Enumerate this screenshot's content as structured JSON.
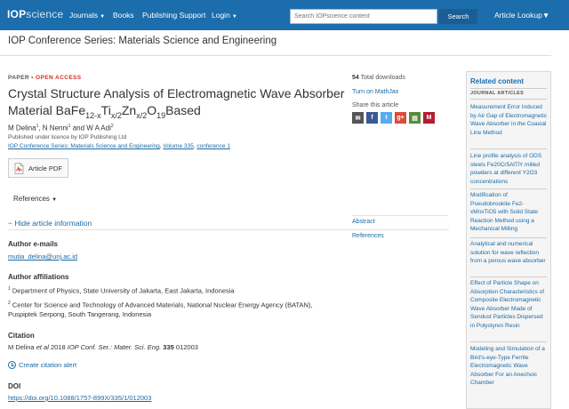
{
  "nav": {
    "logo_prefix": "IOP",
    "logo_suffix": "science",
    "journals": "Journals",
    "books": "Books",
    "publishing_support": "Publishing Support",
    "login": "Login",
    "search_placeholder": "Search IOPscience content",
    "search_button": "Search",
    "article_lookup": "Article Lookup"
  },
  "journal_title": "IOP Conference Series: Materials Science and Engineering",
  "article": {
    "paper_label": "PAPER",
    "separator": "•",
    "open_access": "OPEN ACCESS",
    "title_lines": [
      "Crystal Structure Analysis of Electromagnetic Wave Absorber",
      "Material BaFe",
      "12-x",
      "Ti",
      "x/2",
      "Zn",
      "x/2",
      "O",
      "19",
      "Based"
    ],
    "authors": [
      "M Delina",
      "1",
      ", N Nenni",
      "1",
      " and W A Adi",
      "2"
    ],
    "license": "Published under licence by IOP Publishing Ltd",
    "citation_journal": "IOP Conference Series: Materials Science and Engineering",
    "citation_volume": "Volume 335",
    "citation_conference": "conference 1",
    "pdf_button": "Article PDF",
    "references_toggle": "References",
    "hide_info": "Hide article information",
    "emails_heading": "Author e-mails",
    "email": "mutia_delina@unj.ac.id",
    "affiliations_heading": "Author affiliations",
    "affiliation_1_num": "1",
    "affiliation_1": "Department of Physics, State University of Jakarta, East Jakarta, Indonesia",
    "affiliation_2_num": "2",
    "affiliation_2a": "Center for Science and Technology of Advanced Materials, National Nuclear Energy Agency (BATAN),",
    "affiliation_2b": "Puspiptek Serpong, South Tangerang, Indonesia",
    "citation_heading": "Citation",
    "citation_author": "M Delina ",
    "citation_etal": "et al",
    "citation_year": " 2018 ",
    "citation_journal_abbr": "IOP Conf. Ser.: Mater. Sci. Eng.",
    "citation_vol": "335",
    "citation_article": " 012003",
    "alert": "Create citation alert",
    "doi_heading": "DOI",
    "doi": "https://doi.org/10.1088/1757-899X/335/1/012003"
  },
  "meta": {
    "downloads_count": "54",
    "downloads_label": " Total downloads",
    "mathjax": "Turn on MathJax",
    "share_label": "Share this article",
    "abstract": "Abstract",
    "references": "References",
    "share_icons": [
      {
        "name": "email-icon",
        "glyph": "✉",
        "color": "#555555"
      },
      {
        "name": "facebook-icon",
        "glyph": "f",
        "color": "#3b5998"
      },
      {
        "name": "twitter-icon",
        "glyph": "t",
        "color": "#55acee"
      },
      {
        "name": "google-plus-icon",
        "glyph": "g+",
        "color": "#dd4b39"
      },
      {
        "name": "citeulike-icon",
        "glyph": "▤",
        "color": "#5a8a3a"
      },
      {
        "name": "mendeley-icon",
        "glyph": "M",
        "color": "#b31e2f"
      }
    ]
  },
  "sidebar": {
    "heading": "Related content",
    "subheading": "JOURNAL ARTICLES",
    "items": [
      "Measurement Error Induced by Air Gap of Electromagnetic Wave Absorber in the Coaxial Line Method",
      "Line profile analysis of ODS steels Fe20Cr5AlTiY milled powders at different Y2O3 concentrations",
      "Modification of Pseudobrookite Fe2-xMnxTiO5 with Solid State Reaction Method using a Mechanical Milling",
      "Analytical and numerical solution for wave reflection from a porous wave absorber",
      "Effect of Particle Shape on Absorption Characteristics of Composite Electromagnetic Wave Absorber Made of Sendust Particles Dispersed in Polystyren Resin",
      "Modeling and Simulation of a Bird's-eye-Type Ferrite Electromagnetic Wave Absorber For an Anechoic Chamber"
    ]
  }
}
